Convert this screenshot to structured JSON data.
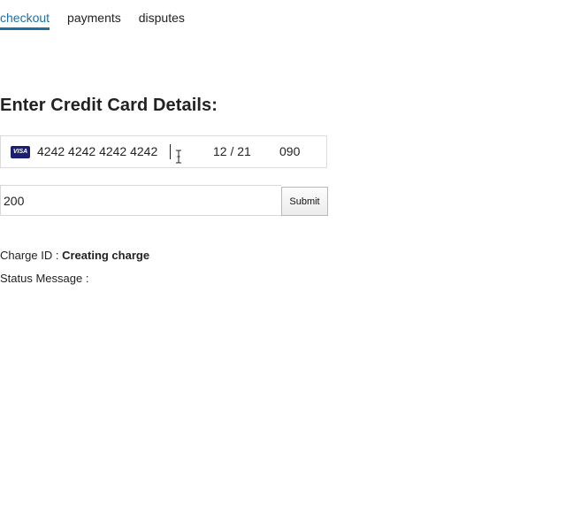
{
  "tabs": [
    {
      "label": "checkout",
      "active": true
    },
    {
      "label": "payments",
      "active": false
    },
    {
      "label": "disputes",
      "active": false
    }
  ],
  "heading": "Enter Credit Card Details:",
  "card": {
    "brand": "VISA",
    "brand_icon": "visa-card-icon",
    "number": "4242 4242 4242 4242",
    "expiry": "12 / 21",
    "cvc": "090"
  },
  "amount": {
    "value": "200"
  },
  "submit_label": "Submit",
  "charge": {
    "label": "Charge ID : ",
    "value": "Creating charge"
  },
  "status": {
    "label": "Status Message : ",
    "value": ""
  },
  "colors": {
    "accent": "#1d6fa5",
    "visa_blue": "#1a1f71",
    "text": "#222222"
  }
}
